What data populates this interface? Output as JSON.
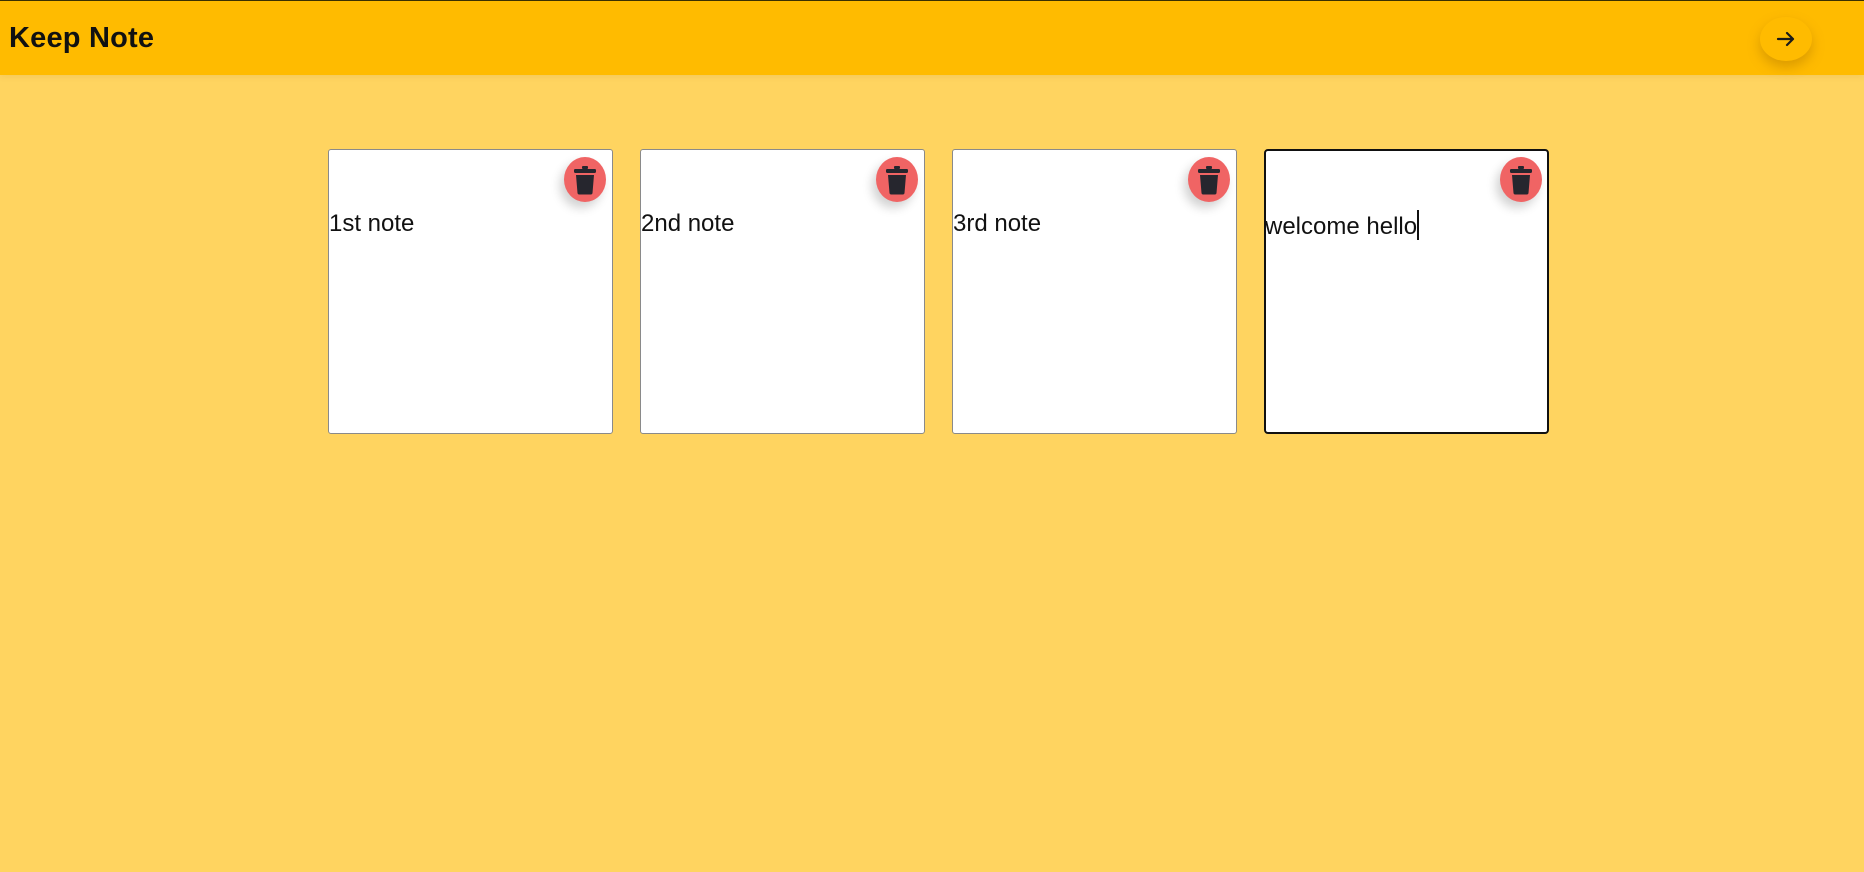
{
  "header": {
    "title": "Keep Note",
    "nav_icon": "arrow-right-icon"
  },
  "notes": [
    {
      "text": "1st note",
      "delete_icon": "trash-icon"
    },
    {
      "text": "2nd note",
      "delete_icon": "trash-icon"
    },
    {
      "text": "3rd note",
      "delete_icon": "trash-icon"
    },
    {
      "text": "welcome hello",
      "delete_icon": "trash-icon"
    }
  ],
  "colors": {
    "background": "#FFD460",
    "header": "#FFBB00",
    "delete_button": "#F06464",
    "note": "#FFFFFF"
  }
}
